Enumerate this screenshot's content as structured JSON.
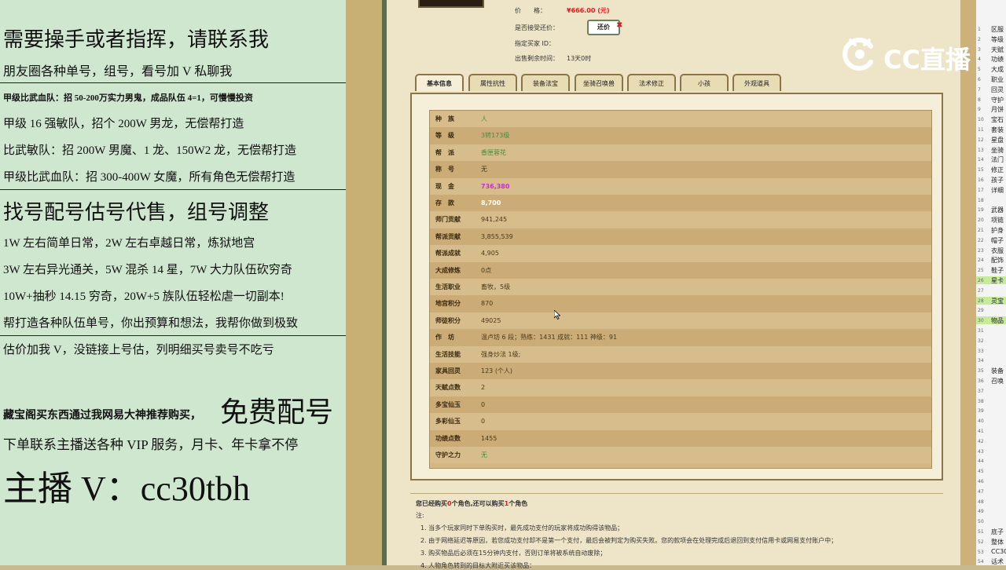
{
  "left_panel": {
    "lines": [
      "需要操手或者指挥，请联系我",
      "朋友圈各种单号，组号，看号加 V 私聊我",
      "甲级比武血队：招 50-200万实力男鬼，成品队伍 4=1，可慢慢投资",
      "甲级 16 强敏队，招个 200W 男龙，无偿帮打造",
      "比武敏队：招 200W 男魔、1 龙、150W2 龙，无偿帮打造",
      "甲级比武血队：招 300-400W 女魔，所有角色无偿帮打造",
      "找号配号估号代售，组号调整",
      "1W 左右简单日常，2W 左右卓越日常，炼狱地宫",
      "3W 左右异光通关，5W 混杀 14 星，7W 大力队伍砍穷奇",
      "10W+抽秒 14.15 穷奇，20W+5 族队伍轻松虐一切副本!",
      "帮打造各种队伍单号，你出预算和想法，我帮你做到极致",
      "估价加我 V，没链接上号估，列明细买号卖号不吃亏",
      "藏宝阁买东西通过我网易大神推荐购买，",
      "免费配号",
      "下单联系主播送各种 VIP 服务，月卡、年卡拿不停",
      "主播 V：cc30tbh"
    ]
  },
  "listing": {
    "price_label": "价　　格：",
    "price_value": "¥666.00 (元)",
    "offer_label": "是否接受还价：",
    "offer_button": "还价",
    "buyer_label": "指定买家 ID：",
    "buyer_value": "",
    "remaining_label": "出售剩余时间：",
    "remaining_value": "13天0时"
  },
  "tabs": [
    "基本信息",
    "属性抗性",
    "装备法宝",
    "坐骑召唤兽",
    "法术修正",
    "小孩",
    "外观道具"
  ],
  "rows": [
    {
      "label": "种　族",
      "value": "人",
      "style": "green"
    },
    {
      "label": "等　级",
      "value": "3转173级",
      "style": "green"
    },
    {
      "label": "帮　派",
      "value": "香匣蓉花",
      "style": "green"
    },
    {
      "label": "称　号",
      "value": "无",
      "style": ""
    },
    {
      "label": "现　金",
      "value": "736,380",
      "style": "magenta"
    },
    {
      "label": "存　款",
      "value": "8,700",
      "style": "white"
    },
    {
      "label": "师门贡献",
      "value": "941,245",
      "style": ""
    },
    {
      "label": "帮派贡献",
      "value": "3,855,539",
      "style": ""
    },
    {
      "label": "帮派成就",
      "value": "4,905",
      "style": ""
    },
    {
      "label": "大成修炼",
      "value": "0点",
      "style": ""
    },
    {
      "label": "生活职业",
      "value": "畜牧，5级",
      "style": ""
    },
    {
      "label": "地宫积分",
      "value": "870",
      "style": ""
    },
    {
      "label": "师徒积分",
      "value": "49025",
      "style": ""
    },
    {
      "label": "作　坊",
      "value": "温卢坊 6 段；熟练：1431  成就：111  神级：91",
      "style": ""
    },
    {
      "label": "生活技能",
      "value": "强身炒法 1级;",
      "style": ""
    },
    {
      "label": "家具回灵",
      "value": "123 (个人)",
      "style": ""
    },
    {
      "label": "天赋点数",
      "value": "2",
      "style": ""
    },
    {
      "label": "多宝仙玉",
      "value": "0",
      "style": ""
    },
    {
      "label": "多彩仙玉",
      "value": "0",
      "style": ""
    },
    {
      "label": "功绩点数",
      "value": "1455",
      "style": ""
    },
    {
      "label": "守护之力",
      "value": "无",
      "style": "green"
    }
  ],
  "footer": {
    "bought_prefix": "您已经购买",
    "bought_count": "0",
    "bought_mid": "个角色,还可以购买",
    "remain_count": "1",
    "bought_suffix": "个角色",
    "note_label": "注:",
    "notes": [
      "1. 当多个玩家同时下单购买时，最先成功支付的玩家将成功购得该物品；",
      "2. 由于网络延迟等原因，若您成功支付却不是第一个支付，最后会被判定为购买失败。您的款项会在处理完成后退回到支付信用卡或网易支付账户中；",
      "3. 购买物品后必须在15分钟内支付，否则订单将被系统自动废除；",
      "4. 人物角色转到的目标大附近买该物品："
    ]
  },
  "watermark": "CC直播",
  "right_pane": [
    {
      "n": "1",
      "t": "区服"
    },
    {
      "n": "2",
      "t": "等级"
    },
    {
      "n": "3",
      "t": "天赋"
    },
    {
      "n": "4",
      "t": "功绩"
    },
    {
      "n": "5",
      "t": "大成"
    },
    {
      "n": "6",
      "t": "职业"
    },
    {
      "n": "7",
      "t": "回灵"
    },
    {
      "n": "8",
      "t": "守护"
    },
    {
      "n": "9",
      "t": "月饼"
    },
    {
      "n": "10",
      "t": "宝石"
    },
    {
      "n": "11",
      "t": "套装"
    },
    {
      "n": "12",
      "t": "星盘"
    },
    {
      "n": "13",
      "t": "坐骑"
    },
    {
      "n": "14",
      "t": "法门"
    },
    {
      "n": "15",
      "t": "修正"
    },
    {
      "n": "16",
      "t": "孩子"
    },
    {
      "n": "17",
      "t": "详细"
    },
    {
      "n": "18",
      "t": ""
    },
    {
      "n": "19",
      "t": "武器"
    },
    {
      "n": "20",
      "t": "项链"
    },
    {
      "n": "21",
      "t": "护身"
    },
    {
      "n": "22",
      "t": "帽子"
    },
    {
      "n": "23",
      "t": "衣服"
    },
    {
      "n": "24",
      "t": "配饰"
    },
    {
      "n": "25",
      "t": "鞋子"
    },
    {
      "n": "26",
      "t": "星卡"
    },
    {
      "n": "27",
      "t": ""
    },
    {
      "n": "28",
      "t": "灵宝"
    },
    {
      "n": "29",
      "t": ""
    },
    {
      "n": "30",
      "t": "物品"
    },
    {
      "n": "31",
      "t": ""
    },
    {
      "n": "32",
      "t": ""
    },
    {
      "n": "33",
      "t": ""
    },
    {
      "n": "34",
      "t": ""
    },
    {
      "n": "35",
      "t": "装备"
    },
    {
      "n": "36",
      "t": "召唤"
    },
    {
      "n": "37",
      "t": ""
    },
    {
      "n": "38",
      "t": ""
    },
    {
      "n": "39",
      "t": ""
    },
    {
      "n": "40",
      "t": ""
    },
    {
      "n": "41",
      "t": ""
    },
    {
      "n": "42",
      "t": ""
    },
    {
      "n": "43",
      "t": ""
    },
    {
      "n": "44",
      "t": ""
    },
    {
      "n": "45",
      "t": ""
    },
    {
      "n": "46",
      "t": ""
    },
    {
      "n": "47",
      "t": ""
    },
    {
      "n": "48",
      "t": ""
    },
    {
      "n": "49",
      "t": ""
    },
    {
      "n": "50",
      "t": ""
    },
    {
      "n": "51",
      "t": "底子"
    },
    {
      "n": "52",
      "t": "整体"
    },
    {
      "n": "53",
      "t": "CC30"
    },
    {
      "n": "54",
      "t": "话术"
    }
  ],
  "colors": {
    "left_bg": "#cfe6cf",
    "page_bg": "#eee5c8",
    "price_red": "#d42020",
    "highlight_green": "#c6ec9a"
  }
}
